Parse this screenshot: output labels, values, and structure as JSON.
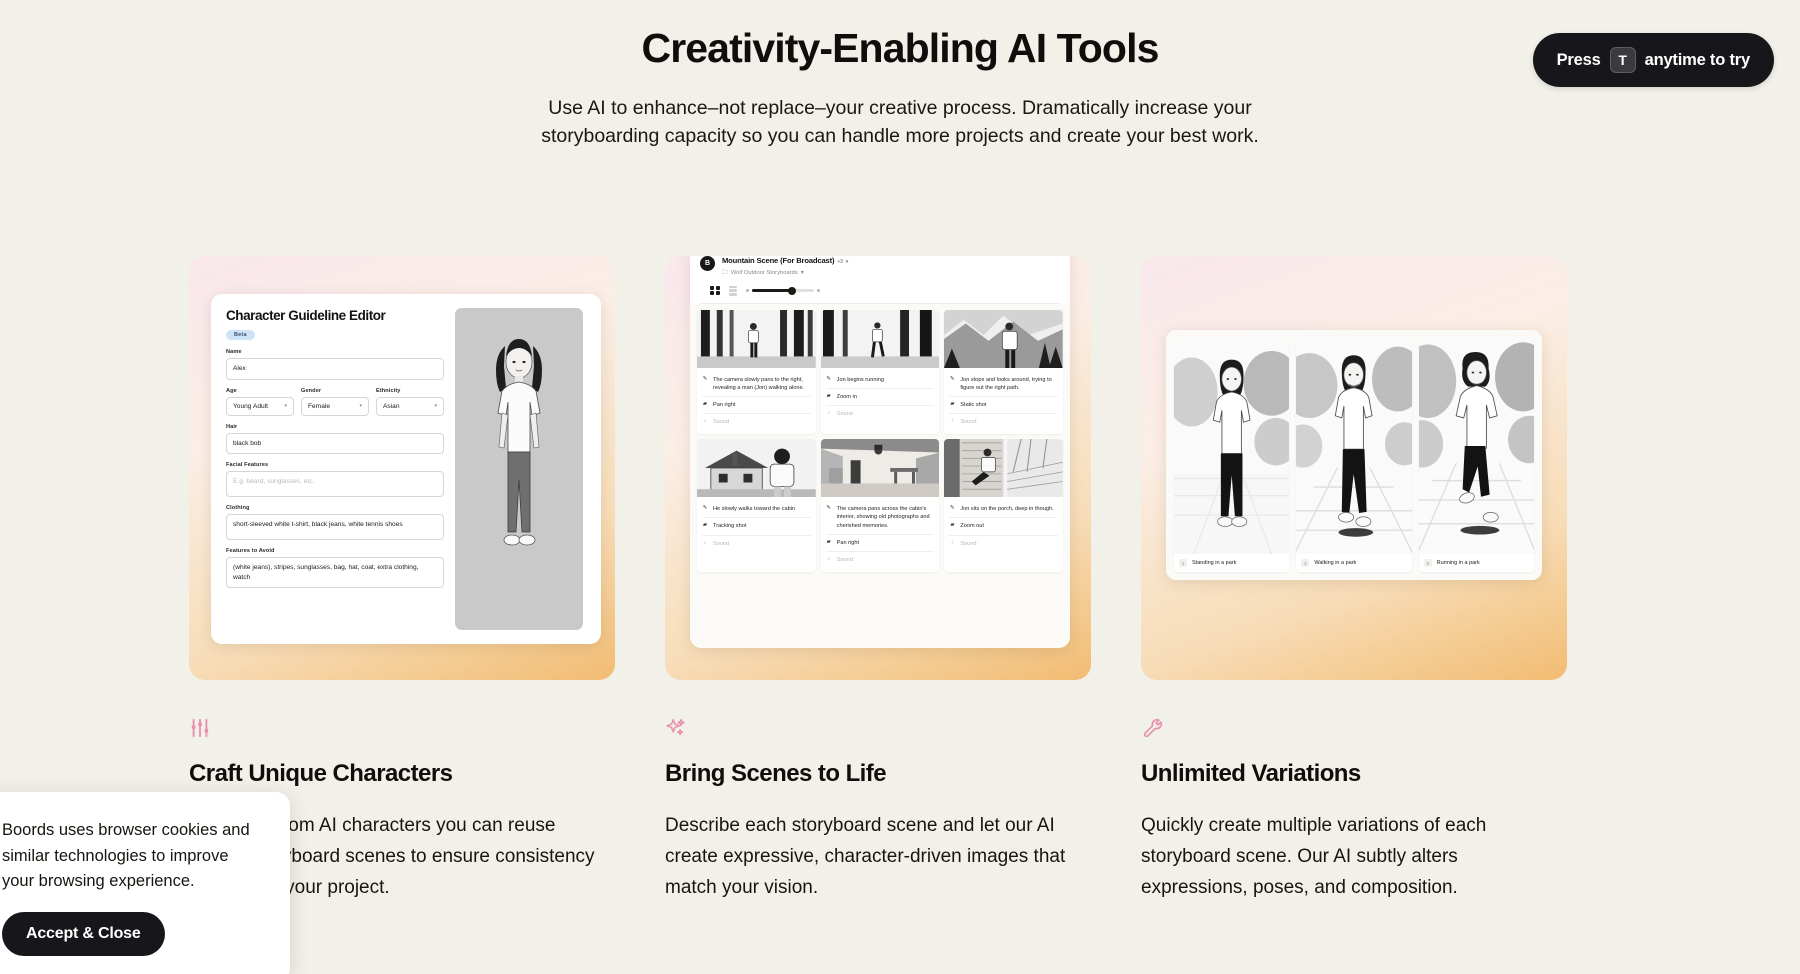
{
  "hero": {
    "title": "Creativity-Enabling AI Tools",
    "subtitle": "Use AI to enhance–not replace–your creative process. Dramatically increase your storyboarding capacity so you can handle more projects and create your best work."
  },
  "press_badge": {
    "prefix": "Press",
    "key": "T",
    "suffix": "anytime to try"
  },
  "character_editor": {
    "title": "Character Guideline Editor",
    "beta_label": "Beta",
    "fields": [
      {
        "label": "Name",
        "value": "Alex"
      },
      {
        "label": "Age",
        "value": "Young Adult"
      },
      {
        "label": "Gender",
        "value": "Female"
      },
      {
        "label": "Ethnicity",
        "value": "Asian"
      },
      {
        "label": "Hair",
        "value": "black bob"
      },
      {
        "label": "Facial Features",
        "value": "",
        "placeholder": "E.g. beard, sunglasses, etc."
      },
      {
        "label": "Clothing",
        "value": "short-sleeved white t-shirt, black jeans, white tennis shoes"
      },
      {
        "label": "Features to Avoid",
        "value": "(white jeans), stripes, sunglasses, bag, hat, coat, extra clothing, watch"
      }
    ]
  },
  "storyboard": {
    "project_title": "Mountain Scene (For Broadcast)",
    "project_badge": "+3",
    "folder": "Wolf Outdoor Storyboards",
    "logo_letter": "B",
    "cells": [
      {
        "description": "The camera slowly pans to the right, revealing a man (Jon) walking alone.",
        "camera": "Pan right",
        "sound": "Sound"
      },
      {
        "description": "Jon begins running",
        "camera": "Zoom in",
        "sound": "Sound"
      },
      {
        "description": "Jon stops and looks around, trying to figure out the right path.",
        "camera": "Static shot",
        "sound": "Sound"
      },
      {
        "description": "He slowly walks toward the cabin",
        "camera": "Tracking shot",
        "sound": "Sound"
      },
      {
        "description": "The camera pans across the cabin's interior, showing old photographs and cherished memories.",
        "camera": "Pan right",
        "sound": "Sound"
      },
      {
        "description": "Jon sits on the porch, deep in though.",
        "camera": "Zoom out",
        "sound": "Sound"
      }
    ]
  },
  "variations": [
    {
      "number": "1",
      "caption": "Standing in a park"
    },
    {
      "number": "2",
      "caption": "Walking in a park"
    },
    {
      "number": "3",
      "caption": "Running in a park"
    }
  ],
  "features": [
    {
      "icon": "sliders-icon",
      "title": "Craft Unique Characters",
      "body": "Design custom AI characters you can reuse across storyboard scenes to ensure consistency throughout your project."
    },
    {
      "icon": "sparkles-icon",
      "title": "Bring Scenes to Life",
      "body": "Describe each storyboard scene and let our AI create expressive, character-driven images that match your vision."
    },
    {
      "icon": "wrench-icon",
      "title": "Unlimited Variations",
      "body": "Quickly create multiple variations of each storyboard scene. Our AI subtly alters expressions, poses, and composition."
    }
  ],
  "cookie_banner": {
    "text": "Boords uses browser cookies and similar technologies to improve your browsing experience.",
    "button_label": "Accept & Close"
  },
  "colors": {
    "page_background": "#f2f1e9",
    "accent_pink": "#e98fae",
    "dark": "#17161a",
    "gradient_top": "#f9e7ec",
    "gradient_bottom": "#f2bc72"
  }
}
